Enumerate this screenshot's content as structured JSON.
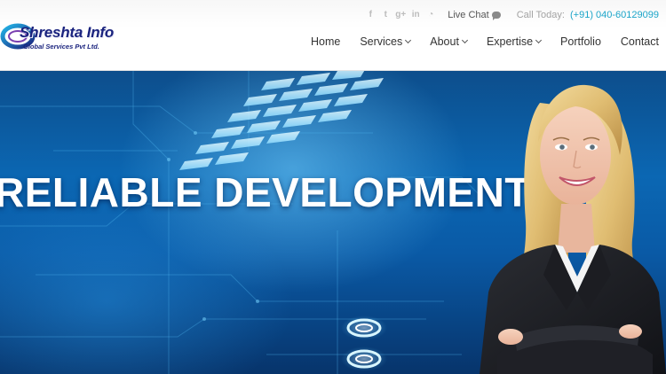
{
  "brand": {
    "name": "Shreshta Info",
    "subtitle": "Global Services Pvt Ltd."
  },
  "topbar": {
    "social": [
      {
        "icon": "facebook-icon",
        "glyph": "f"
      },
      {
        "icon": "twitter-icon",
        "glyph": "t"
      },
      {
        "icon": "google-plus-icon",
        "glyph": "g+"
      },
      {
        "icon": "linkedin-icon",
        "glyph": "in"
      },
      {
        "icon": "rss-icon",
        "glyph": "◔"
      }
    ],
    "live_chat": "Live Chat",
    "call_label": "Call Today:",
    "phone": "(+91) 040-60129099"
  },
  "nav": {
    "items": [
      {
        "label": "Home",
        "dropdown": false
      },
      {
        "label": "Services",
        "dropdown": true
      },
      {
        "label": "About",
        "dropdown": true
      },
      {
        "label": "Expertise",
        "dropdown": true
      },
      {
        "label": "Portfolio",
        "dropdown": false
      },
      {
        "label": "Contact",
        "dropdown": false
      }
    ]
  },
  "hero": {
    "title": "RELIABLE DEVELOPMENT"
  },
  "colors": {
    "accent": "#1ba5c9",
    "brand": "#1a237e",
    "hero_blue": "#0b67b3"
  }
}
